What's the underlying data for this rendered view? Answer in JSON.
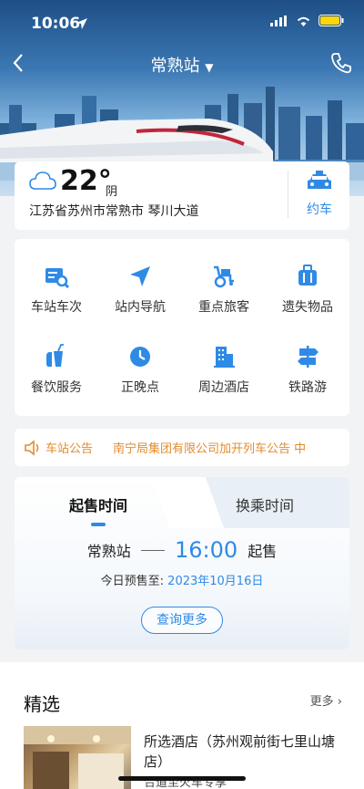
{
  "status_bar": {
    "time": "10:06"
  },
  "nav": {
    "title": "常熟站"
  },
  "weather": {
    "temperature": "22°",
    "condition": "阴",
    "address": "江苏省苏州市常熟市 琴川大道",
    "taxi_label": "约车"
  },
  "services": [
    {
      "label": "车站车次",
      "icon": "schedule-search-icon"
    },
    {
      "label": "站内导航",
      "icon": "navigation-icon"
    },
    {
      "label": "重点旅客",
      "icon": "wheelchair-icon"
    },
    {
      "label": "遗失物品",
      "icon": "luggage-icon"
    },
    {
      "label": "餐饮服务",
      "icon": "drink-food-icon"
    },
    {
      "label": "正晚点",
      "icon": "clock-icon"
    },
    {
      "label": "周边酒店",
      "icon": "hotel-icon"
    },
    {
      "label": "铁路游",
      "icon": "signpost-icon"
    }
  ],
  "notice": {
    "label": "车站公告",
    "text": "南宁局集团有限公司加开列车公告  中"
  },
  "tabs": {
    "active": "起售时间",
    "inactive": "换乘时间"
  },
  "sale": {
    "station": "常熟站",
    "time": "16:00",
    "suffix": "起售",
    "presale_label": "今日预售至:",
    "presale_date": "2023年10月16日",
    "more_button": "查询更多"
  },
  "featured": {
    "title": "精选",
    "more": "更多",
    "hotel_name": "所选酒店（苏州观前街七里山塘店）",
    "hotel_sub": "合道至火车专享"
  },
  "colors": {
    "accent": "#2f8ae6",
    "notice": "#e38b2f"
  }
}
